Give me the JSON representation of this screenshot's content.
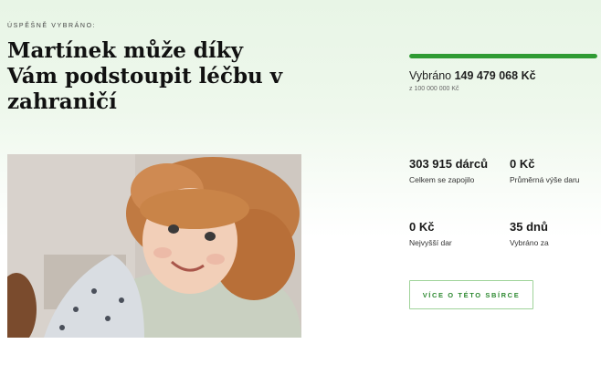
{
  "header": {
    "eyebrow": "ÚSPĚŠNĚ VYBRÁNO:",
    "title": "Martínek může díky Vám podstoupit léčbu v zahraničí"
  },
  "photo": {
    "alt": "Photo of a smiling curly-haired toddler hugging an adult"
  },
  "progress": {
    "fraction": 1.0,
    "raised_prefix": "Vybráno",
    "raised_amount": "149 479 068 Kč",
    "goal": "z 100 000 000 Kč"
  },
  "stats": {
    "donors_value": "303 915 dárců",
    "donors_label": "Celkem se zapojilo",
    "avg_value": "0 Kč",
    "avg_label": "Průměrná výše daru",
    "max_value": "0 Kč",
    "max_label": "Nejvyšší dar",
    "days_value": "35 dnů",
    "days_label": "Vybráno za"
  },
  "actions": {
    "more_label": "VÍCE O TÉTO SBÍRCE"
  },
  "colors": {
    "accent": "#2f9b33",
    "background_top": "#e8f5e6"
  }
}
